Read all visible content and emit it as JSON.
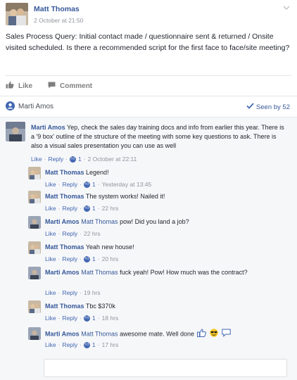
{
  "post": {
    "author": "Matt Thomas",
    "time": "2 October at 21:50",
    "body": "Sales Process Query: Initial contact made / questionnaire sent & returned / Onsite visited scheduled. Is there a recommended script for the first face to face/site meeting?"
  },
  "actions": {
    "like": "Like",
    "comment": "Comment"
  },
  "viewer": {
    "name": "Marti Amos",
    "seen_by": "Seen by 52"
  },
  "comments": [
    {
      "author": "Marti Amos",
      "tag": "",
      "text": "Yep, check the sales day training docs and info from earlier this year. There is a '9 box' outline of the structure of the meeting with some key questions to ask. There is also a visual sales presentation you can use as well",
      "like": "Like",
      "reply": "Reply",
      "likes": "1",
      "time": "2 October at 22:11"
    },
    {
      "author": "Matt Thomas",
      "tag": "",
      "text": "Legend!",
      "like": "Like",
      "reply": "Reply",
      "likes": "1",
      "time": "Yesterday at 13:45"
    },
    {
      "author": "Matt Thomas",
      "tag": "",
      "text": "The system works! Nailed it!",
      "like": "Like",
      "reply": "Reply",
      "likes": "1",
      "time": "22 hrs"
    },
    {
      "author": "Marti Amos",
      "tag": "Matt Thomas",
      "text": "pow! Did you land a job?",
      "like": "Like",
      "reply": "Reply",
      "likes": "",
      "time": "22 hrs"
    },
    {
      "author": "Matt Thomas",
      "tag": "",
      "text": "Yeah new house!",
      "like": "Like",
      "reply": "Reply",
      "likes": "1",
      "time": "20 hrs"
    },
    {
      "author": "Marti Amos",
      "tag": "Matt Thomas",
      "text": "fuck yeah! Pow! How much was the contract?",
      "like": "Like",
      "reply": "Reply",
      "likes": "",
      "time": "19 hrs"
    },
    {
      "author": "Matt Thomas",
      "tag": "",
      "text": "Tbc $370k",
      "like": "Like",
      "reply": "Reply",
      "likes": "1",
      "time": "18 hrs"
    },
    {
      "author": "Marti Amos",
      "tag": "Matt Thomas",
      "text": "awesome mate. Well done",
      "like": "Like",
      "reply": "Reply",
      "likes": "1",
      "time": "17 hrs"
    }
  ],
  "colors": {
    "link": "#365899",
    "meta": "#90949c",
    "accent": "#4267b2",
    "comments_bg": "#f6f7f9"
  },
  "icons": [
    "chevron-down-icon",
    "thumbs-up-icon",
    "comment-icon",
    "seen-check-icon",
    "like-badge-icon",
    "thumbs-up-emoji-icon",
    "sunglasses-emoji-icon",
    "speech-bubble-emoji-icon"
  ]
}
